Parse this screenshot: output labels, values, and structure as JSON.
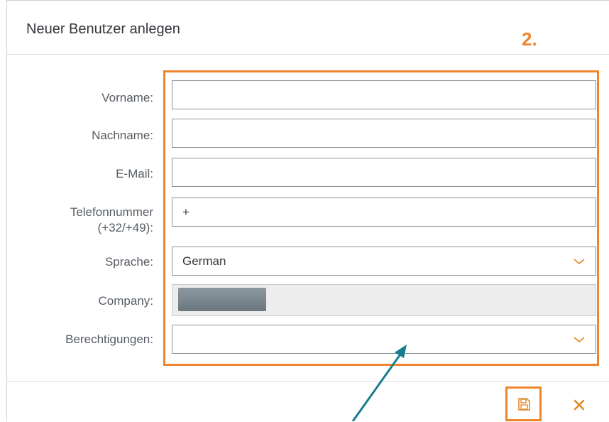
{
  "dialog": {
    "title": "Neuer Benutzer anlegen",
    "step_label": "2."
  },
  "form": {
    "fields": [
      {
        "label": "Vorname:",
        "value": ""
      },
      {
        "label": "Nachname:",
        "value": ""
      },
      {
        "label": "E-Mail:",
        "value": ""
      },
      {
        "label_line1": "Telefonnummer",
        "label_line2": "(+32/+49):",
        "value": "+"
      },
      {
        "label": "Sprache:",
        "value": "German"
      },
      {
        "label": "Company:",
        "value": ""
      },
      {
        "label": "Berechtigungen:",
        "value": ""
      }
    ]
  },
  "footer": {
    "save_icon": "save-icon",
    "close_icon": "close-icon"
  },
  "colors": {
    "highlight": "#f0852d",
    "arrow": "#1a7d8f",
    "icon_orange": "#e08a2a"
  }
}
